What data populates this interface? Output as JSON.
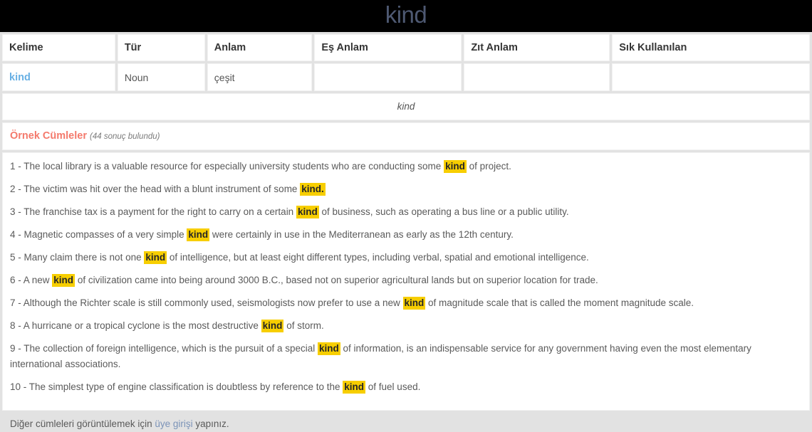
{
  "banner": {
    "title": "kind",
    "title_color": "#4e5972",
    "background": "#000000"
  },
  "word_table": {
    "headers": [
      "Kelime",
      "Tür",
      "Anlam",
      "Eş Anlam",
      "Zıt Anlam",
      "Sık Kullanılan"
    ],
    "rows": [
      {
        "kelime": "kind",
        "tur": "Noun",
        "anlam": "çeşit",
        "es_anlam": "",
        "zit_anlam": "",
        "sik_kullanilan": ""
      }
    ],
    "link_color": "#68b0e4"
  },
  "word_echo": {
    "text": "kind"
  },
  "examples_heading": {
    "label": "Örnek Cümleler",
    "count_text": "(44 sonuç bulundu)",
    "label_color": "#f4796b"
  },
  "highlight": {
    "term": "kind",
    "background": "#f7ce00"
  },
  "sentences": [
    {
      "number": "1 - ",
      "pre": "The local library is a valuable resource for especially university students who are conducting some ",
      "mark": "kind",
      "post": " of project."
    },
    {
      "number": "2 - ",
      "pre": "The victim was hit over the head with a blunt instrument of some ",
      "mark": "kind.",
      "post": ""
    },
    {
      "number": "3 - ",
      "pre": "The franchise tax is a payment for the right to carry on a certain ",
      "mark": "kind",
      "post": " of business, such as operating a bus line or a public utility."
    },
    {
      "number": "4 - ",
      "pre": "Magnetic compasses of a very simple ",
      "mark": "kind",
      "post": " were certainly in use in the Mediterranean as early as the 12th century."
    },
    {
      "number": "5 - ",
      "pre": "Many claim there is not one ",
      "mark": "kind",
      "post": " of intelligence, but at least eight different types, including verbal, spatial and emotional intelligence."
    },
    {
      "number": "6 - ",
      "pre": "A new ",
      "mark": "kind",
      "post": " of civilization came into being around 3000 B.C., based not on superior agricultural lands but on superior location for trade."
    },
    {
      "number": "7 - ",
      "pre": "Although the Richter scale is still commonly used, seismologists now prefer to use a new ",
      "mark": "kind",
      "post": " of magnitude scale that is called the moment magnitude scale."
    },
    {
      "number": "8 - ",
      "pre": "A hurricane or a tropical cyclone is the most destructive ",
      "mark": "kind",
      "post": " of storm."
    },
    {
      "number": "9 - ",
      "pre": "The collection of foreign intelligence, which is the pursuit of a special ",
      "mark": "kind",
      "post": " of information, is an indispensable service for any government having even the most elementary international associations."
    },
    {
      "number": "10 - ",
      "pre": "The simplest type of engine classification is doubtless by reference to the ",
      "mark": "kind",
      "post": " of fuel used."
    }
  ],
  "footer": {
    "pre": "Diğer cümleleri görüntülemek için ",
    "link": "üye girişi",
    "post": " yapınız.",
    "link_color": "#7b93b8"
  }
}
